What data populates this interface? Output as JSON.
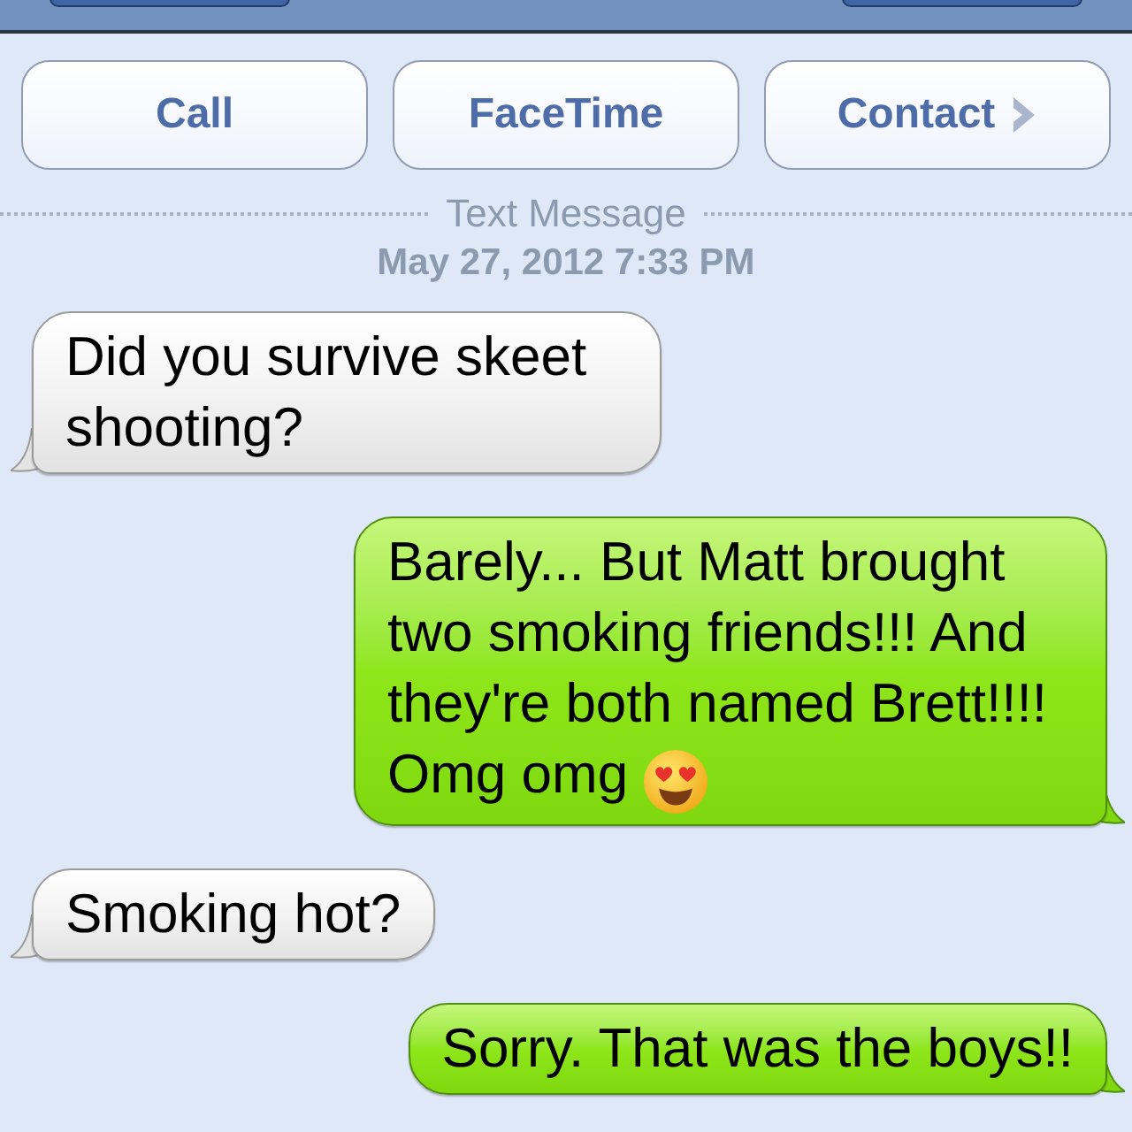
{
  "actions": [
    {
      "label": "Call",
      "chevron": false
    },
    {
      "label": "FaceTime",
      "chevron": false
    },
    {
      "label": "Contact",
      "chevron": true
    }
  ],
  "divider_label": "Text Message",
  "timestamp": "May 27, 2012 7:33 PM",
  "messages": [
    {
      "kind": "received",
      "text": "Did you survive skeet shooting?",
      "emoji": false
    },
    {
      "kind": "sent",
      "text": "Barely... But Matt brought two smoking friends!!! And they're both named Brett!!!! Omg omg",
      "emoji": true
    },
    {
      "kind": "received",
      "text": "Smoking hot?",
      "emoji": false
    },
    {
      "kind": "sent",
      "text": "Sorry. That was the boys!!",
      "emoji": false
    }
  ]
}
